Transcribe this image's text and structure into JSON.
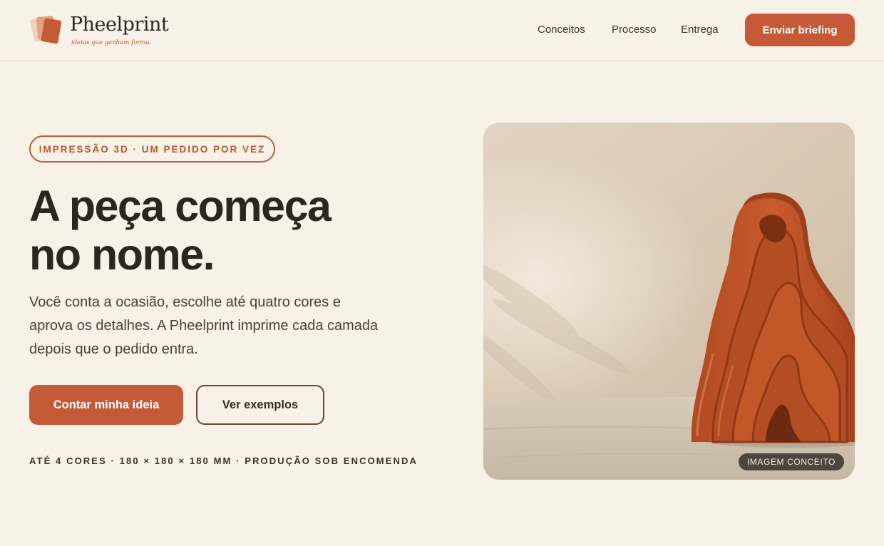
{
  "brand": {
    "name": "Pheelprint",
    "tagline": "ideias que ganham forma.",
    "logo_icon": "stacked-cards-icon",
    "accent": "#c45a38"
  },
  "nav": {
    "items": [
      {
        "label": "Conceitos"
      },
      {
        "label": "Processo"
      },
      {
        "label": "Entrega"
      }
    ],
    "cta_label": "Enviar briefing"
  },
  "hero": {
    "pill": "IMPRESSÃO 3D · UM PEDIDO POR VEZ",
    "headline_line1": "A peça começa",
    "headline_line2": "no nome.",
    "lead": "Você conta a ocasião, escolhe até quatro cores e aprova os detalhes. A Pheelprint imprime cada camada depois que o pedido entra.",
    "primary_cta": "Contar minha ideia",
    "secondary_cta": "Ver exemplos",
    "specs": "ATÉ 4 CORES · 180 × 180 × 180 MM · PRODUÇÃO SOB ENCOMENDA"
  },
  "concept_image": {
    "badge": "IMAGEM CONCEITO",
    "subject": "terracotta-layered-wave-sculpture"
  },
  "colors": {
    "background": "#f7f1e8",
    "text": "#2b2620",
    "secondary_border": "#6b4434"
  }
}
